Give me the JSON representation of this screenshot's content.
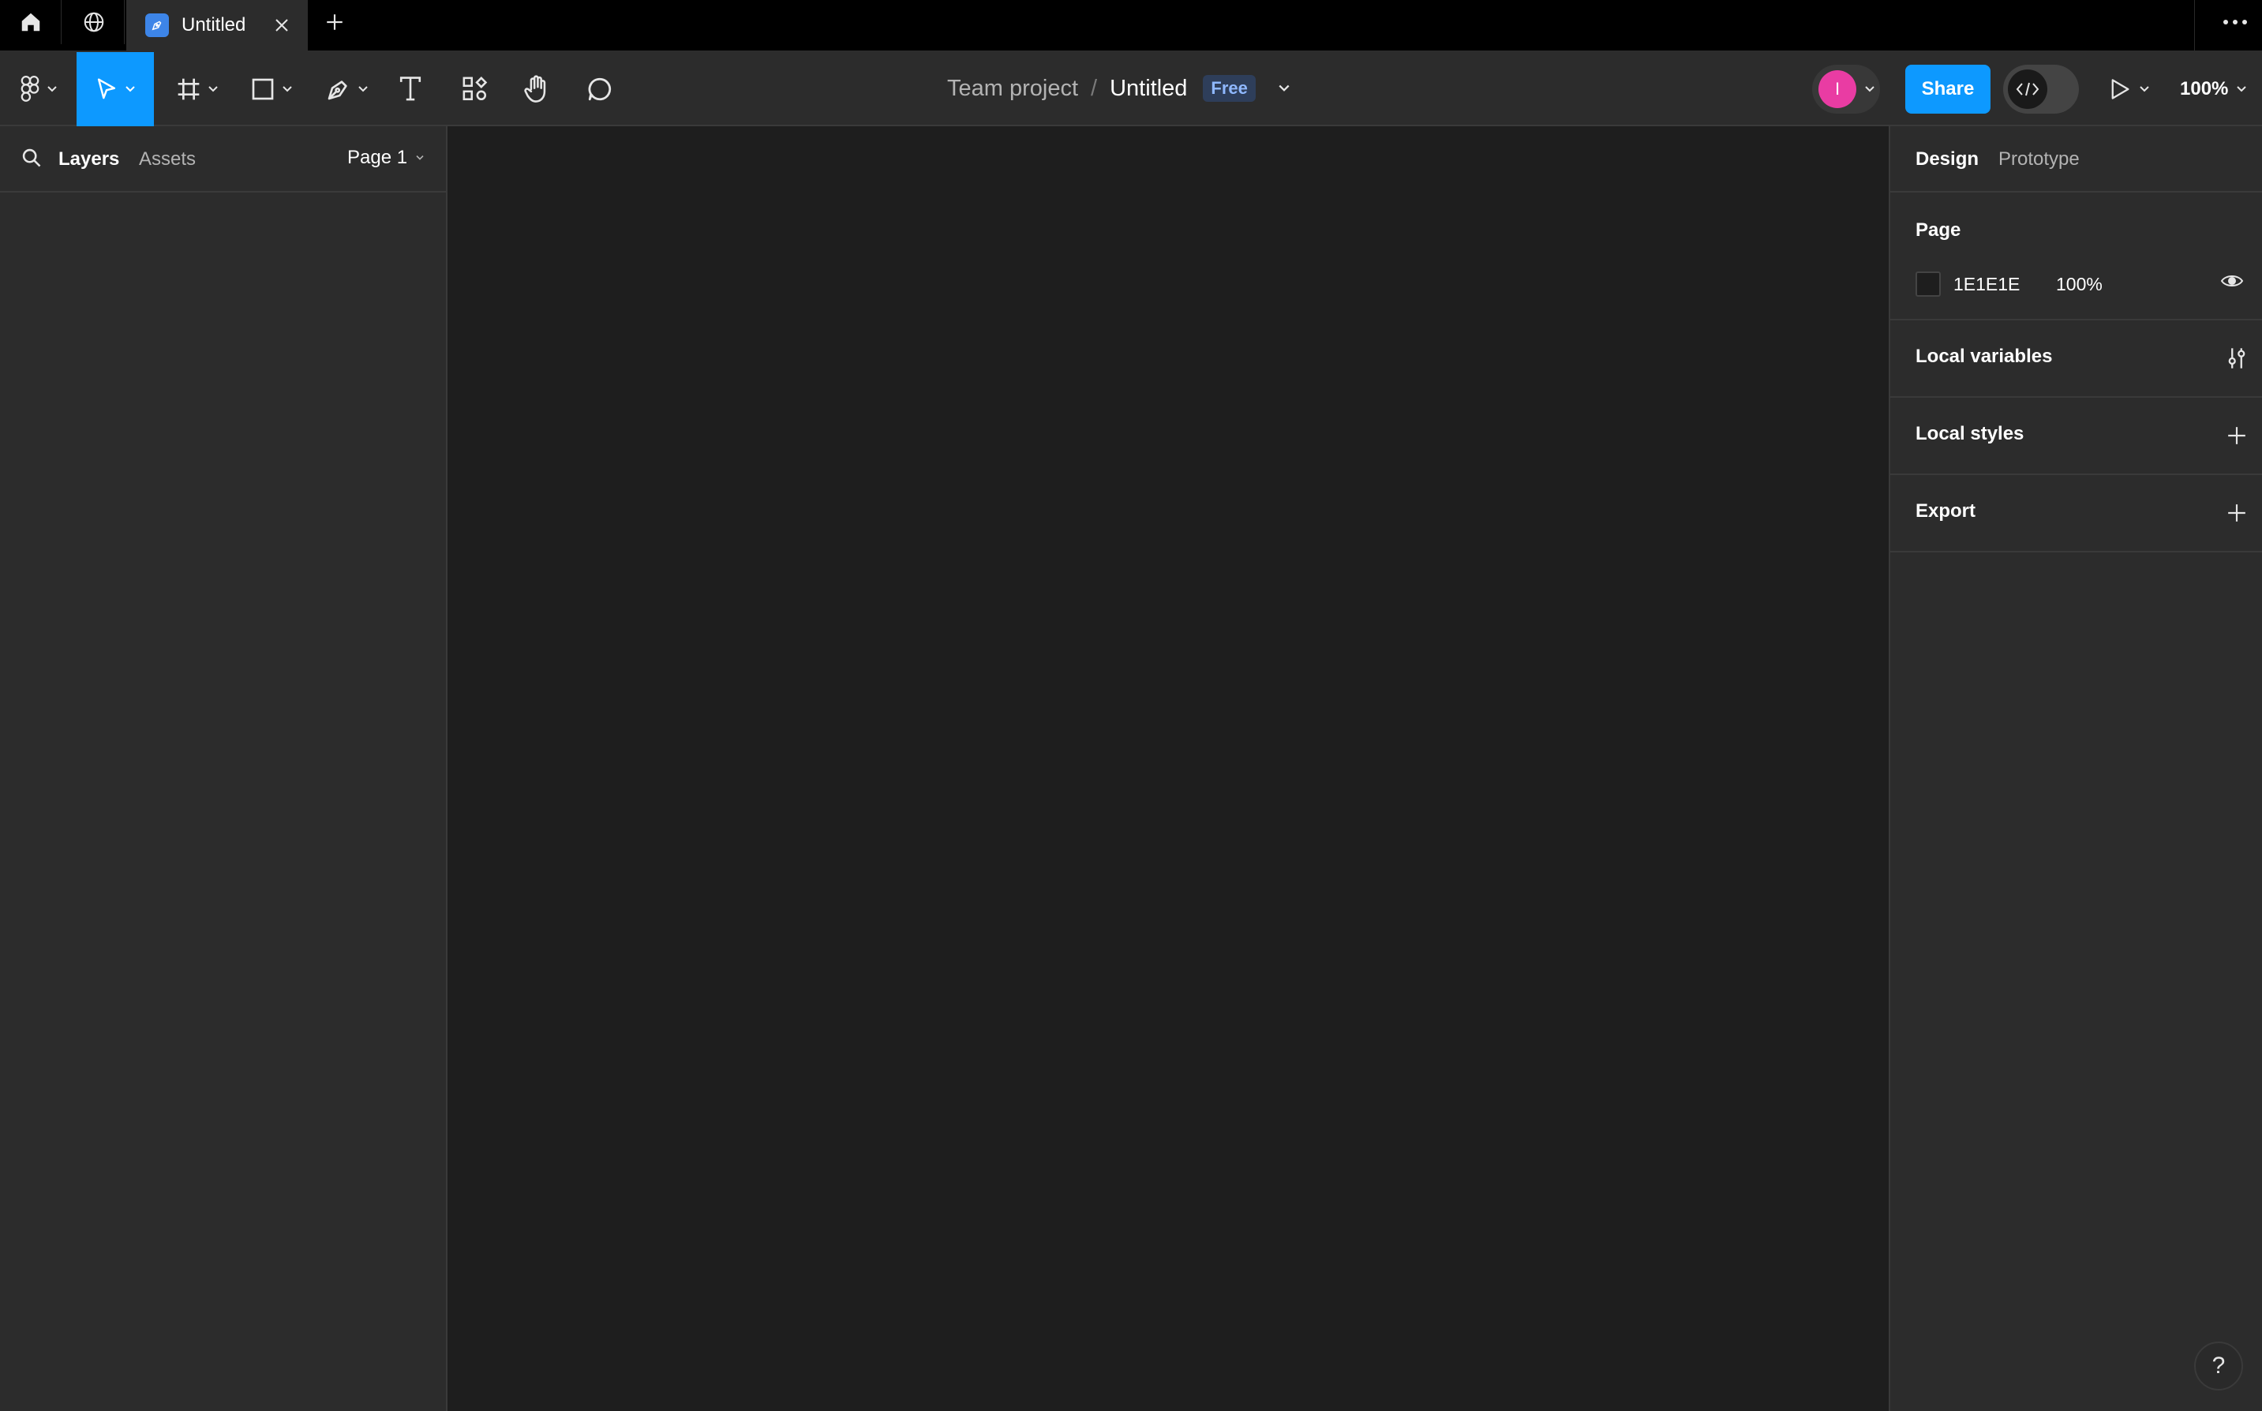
{
  "tabbar": {
    "home_icon": "home-icon",
    "community_icon": "globe-icon",
    "active_tab": {
      "title": "Untitled",
      "icon": "figma-file-icon"
    },
    "add_icon": "plus-icon",
    "more_icon": "more-horizontal-icon"
  },
  "toolbar": {
    "tools": [
      {
        "name": "main-menu",
        "icon": "figma-logo-icon",
        "has_dropdown": true
      },
      {
        "name": "move",
        "icon": "move-cursor-icon",
        "has_dropdown": true,
        "active": true
      },
      {
        "name": "frame",
        "icon": "frame-hash-icon",
        "has_dropdown": true
      },
      {
        "name": "shape",
        "icon": "rectangle-icon",
        "has_dropdown": true
      },
      {
        "name": "pen",
        "icon": "pen-icon",
        "has_dropdown": true
      },
      {
        "name": "text",
        "icon": "text-icon",
        "has_dropdown": false
      },
      {
        "name": "resources",
        "icon": "resources-icon",
        "has_dropdown": false
      },
      {
        "name": "hand",
        "icon": "hand-icon",
        "has_dropdown": false
      },
      {
        "name": "comment",
        "icon": "comment-icon",
        "has_dropdown": false
      }
    ],
    "breadcrumb": {
      "team": "Team project",
      "separator": "/",
      "file": "Untitled",
      "plan_badge": "Free"
    },
    "avatar_initial": "I",
    "avatar_color": "#e93ca3",
    "share_label": "Share",
    "dev_mode_icon": "code-icon",
    "present_icon": "play-icon",
    "zoom_label": "100%"
  },
  "left_panel": {
    "search_icon": "search-icon",
    "tabs": [
      "Layers",
      "Assets"
    ],
    "active_tab": "Layers",
    "page_selector": "Page 1"
  },
  "right_panel": {
    "tabs": [
      "Design",
      "Prototype"
    ],
    "active_tab": "Design",
    "page_section": {
      "title": "Page",
      "fill_hex": "1E1E1E",
      "fill_opacity": "100%",
      "fill_color": "#1e1e1e"
    },
    "sections": [
      {
        "title": "Local variables",
        "action_icon": "variables-sliders-icon"
      },
      {
        "title": "Local styles",
        "action_icon": "plus-icon"
      },
      {
        "title": "Export",
        "action_icon": "plus-icon"
      }
    ]
  },
  "help_label": "?",
  "colors": {
    "accent": "#0d99ff",
    "panel": "#2c2c2c",
    "canvas": "#1e1e1e",
    "chrome": "#000000"
  }
}
